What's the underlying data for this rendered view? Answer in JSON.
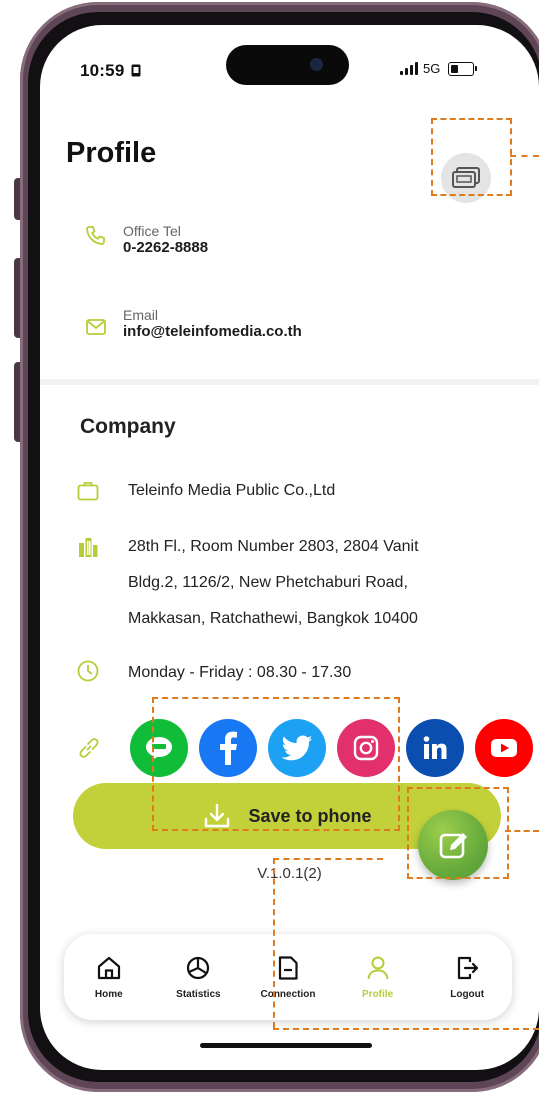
{
  "status": {
    "time": "10:59",
    "network": "5G",
    "battery_level": 0.4
  },
  "header": {
    "title": "Profile",
    "card_icon": "namecard-icon"
  },
  "contacts": [
    {
      "label": "Office Tel",
      "value": "0-2262-8888",
      "icon": "phone-icon"
    },
    {
      "label": "Email",
      "value": "info@teleinfomedia.co.th",
      "icon": "mail-icon"
    }
  ],
  "company": {
    "title": "Company",
    "name": "Teleinfo Media Public Co.,Ltd",
    "address_lines": [
      "28th Fl., Room Number 2803, 2804 Vanit",
      "Bldg.2, 1126/2, New Phetchaburi Road,",
      "Makkasan, Ratchathewi, Bangkok 10400"
    ],
    "hours": "Monday  - Friday : 08.30 - 17.30"
  },
  "social": [
    {
      "name": "line-icon",
      "color": "#0fbd39",
      "glyph": "LINE"
    },
    {
      "name": "facebook-icon",
      "color": "#1877f2",
      "glyph": "f"
    },
    {
      "name": "twitter-icon",
      "color": "#1da1f2",
      "glyph": "t"
    },
    {
      "name": "instagram-icon",
      "color": "#e1306c",
      "glyph": "ig"
    },
    {
      "name": "linkedin-icon",
      "color": "#0a66c2",
      "glyph": "in"
    },
    {
      "name": "youtube-icon",
      "color": "#ff0000",
      "glyph": "yt"
    }
  ],
  "actions": {
    "save_label": "Save to phone"
  },
  "version": "V.1.0.1(2)",
  "nav": [
    {
      "label": "Home",
      "icon": "home-icon",
      "active": false
    },
    {
      "label": "Statistics",
      "icon": "statistics-icon",
      "active": false
    },
    {
      "label": "Connection",
      "icon": "connection-icon",
      "active": false
    },
    {
      "label": "Profile",
      "icon": "profile-icon",
      "active": true
    },
    {
      "label": "Logout",
      "icon": "logout-icon",
      "active": false
    }
  ],
  "colors": {
    "accent": "#c2d13a",
    "icon_green": "#b7cc39",
    "fab": "#6fb23f",
    "annotation": "#e07a1f"
  }
}
